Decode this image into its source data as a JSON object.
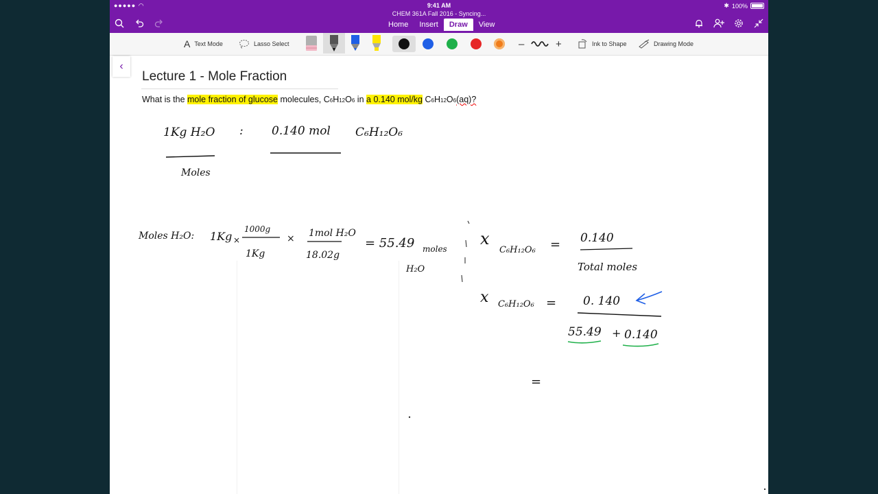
{
  "status_bar": {
    "signal": "●●●●● ",
    "time": "9:41 AM",
    "battery": "100%"
  },
  "notebook": {
    "title": "CHEM 361A Fall 2016 - Syncing..."
  },
  "tabs": [
    {
      "label": "Home"
    },
    {
      "label": "Insert"
    },
    {
      "label": "Draw"
    },
    {
      "label": "View"
    }
  ],
  "ribbon": {
    "text_mode": "Text Mode",
    "lasso_select": "Lasso Select",
    "ink_to_shape": "Ink to Shape",
    "drawing_mode": "Drawing Mode",
    "colors": {
      "black": "#111111",
      "blue": "#1f5fe6",
      "green": "#1fb04a",
      "red": "#e62626",
      "orange": "#f07c1b"
    }
  },
  "page": {
    "title": "Lecture 1 - Mole Fraction",
    "question": {
      "p1": "What is the ",
      "hl1": "mole fraction of glucose",
      "p2": " molecules, C",
      "s1": "6",
      "p3": "H",
      "s2": "12",
      "p4": "O",
      "s3": "6",
      "p5": " in ",
      "hl2": "a 0.140 mol/kg",
      "p6": " C",
      "s4": "6",
      "p7": "H",
      "s5": "12",
      "p8": "O",
      "s6": "6",
      "p9": "(aq)?"
    }
  },
  "handwriting": {
    "l1a": "1Kg  H₂O",
    "l1b": ":",
    "l1c": "0.140 mol",
    "l1d": "C₆H₁₂O₆",
    "moles": "Moles",
    "l2a": "Moles H₂O:",
    "l2b": "1Kg",
    "l2c": "×",
    "l2d": "1000g",
    "l2e": "1Kg",
    "l2f": "×",
    "l2g": "1mol H₂O",
    "l2h": "18.02g",
    "l2i": "= 55.49",
    "l2j": "moles",
    "l2k": "H₂O",
    "x1": "x",
    "x1sub": "C₆H₁₂O₆",
    "x1eq": "=",
    "x1num": "0.140",
    "x1den": "Total moles",
    "x2": "x",
    "x2sub": "C₆H₁₂O₆",
    "x2eq": "=",
    "x2num": "0. 140",
    "x2d1": "55.49",
    "x2plus": "+",
    "x2d2": "0.140",
    "eq3": "="
  }
}
